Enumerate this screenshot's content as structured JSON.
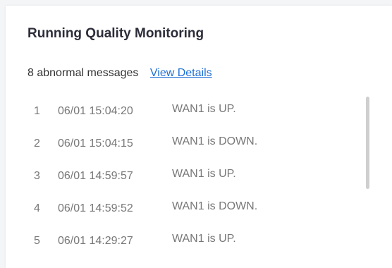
{
  "panel": {
    "title": "Running Quality Monitoring",
    "summary_text": "8 abnormal messages",
    "details_link": "View Details"
  },
  "messages": [
    {
      "index": "1",
      "time": "06/01 15:04:20",
      "text": "WAN1 is UP."
    },
    {
      "index": "2",
      "time": "06/01 15:04:15",
      "text": "WAN1 is DOWN."
    },
    {
      "index": "3",
      "time": "06/01 14:59:57",
      "text": "WAN1 is UP."
    },
    {
      "index": "4",
      "time": "06/01 14:59:52",
      "text": "WAN1 is DOWN."
    },
    {
      "index": "5",
      "time": "06/01 14:29:27",
      "text": "WAN1 is UP."
    }
  ]
}
